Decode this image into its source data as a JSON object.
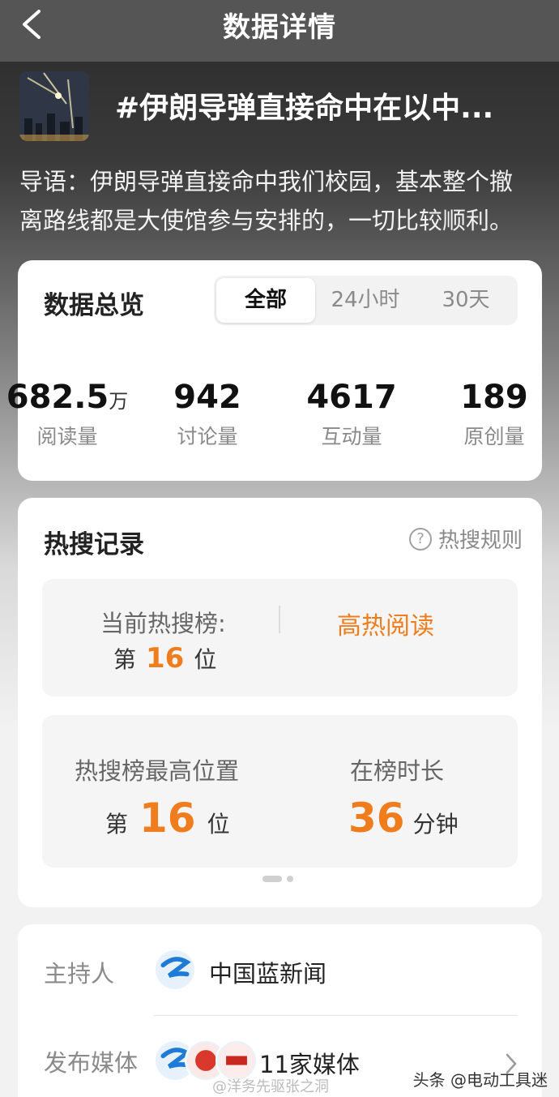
{
  "nav": {
    "title": "数据详情"
  },
  "topic": {
    "title": "#伊朗导弹直接命中在以中...",
    "intro_line1": "导语：伊朗导弹直接命中我们校园，基本整个撤",
    "intro_line2": "离路线都是大使馆参与安排的，一切比较顺利。"
  },
  "overview": {
    "title": "数据总览",
    "tabs": [
      {
        "label": "全部",
        "active": true
      },
      {
        "label": "24小时",
        "active": false
      },
      {
        "label": "30天",
        "active": false
      }
    ],
    "stats": [
      {
        "value": "682.5",
        "unit": "万",
        "label": "阅读量"
      },
      {
        "value": "942",
        "unit": "",
        "label": "讨论量"
      },
      {
        "value": "4617",
        "unit": "",
        "label": "互动量"
      },
      {
        "value": "189",
        "unit": "",
        "label": "原创量"
      }
    ]
  },
  "hotsearch": {
    "title": "热搜记录",
    "rules_label": "热搜规则",
    "current_label": "当前热搜榜:",
    "current_prefix": "第",
    "current_rank": "16",
    "current_suffix": "位",
    "hot_read": "高热阅读",
    "peak_label": "热搜榜最高位置",
    "peak_prefix": "第",
    "peak_rank": "16",
    "peak_suffix": "位",
    "duration_label": "在榜时长",
    "duration_value": "36",
    "duration_unit": "分钟"
  },
  "media": {
    "host_label": "主持人",
    "host_name": "中国蓝新闻",
    "publish_label": "发布媒体",
    "publish_value": "11家媒体"
  },
  "watermark": {
    "text": "头条 @电动工具迷",
    "weibo": "@洋务先驱张之洞"
  },
  "colors": {
    "accent": "#ef7d1d",
    "nav_bg": "#555555"
  }
}
